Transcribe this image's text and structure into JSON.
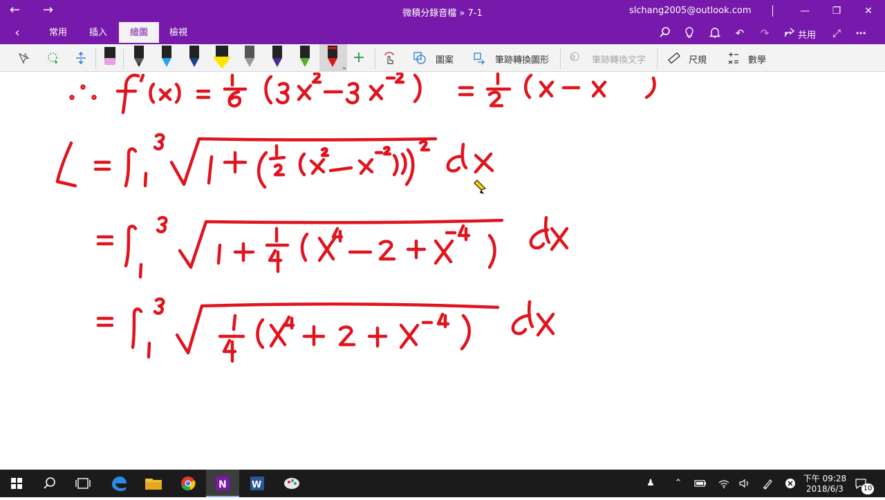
{
  "window": {
    "title": "微積分錄音檔 » 7-1",
    "account": "slchang2005@outlook.com",
    "back_icon": "back-arrow-icon",
    "forward_icon": "forward-arrow-icon"
  },
  "ribbon": {
    "tabs": [
      {
        "label": "常用"
      },
      {
        "label": "插入"
      },
      {
        "label": "繪圖",
        "active": true
      },
      {
        "label": "檢視"
      }
    ],
    "share_label": "共用",
    "accent": "#7719aa"
  },
  "toolbar": {
    "shapes_label": "圖案",
    "ink_to_shape_label": "筆跡轉換圖形",
    "ink_to_text_label": "筆跡轉換文字",
    "ruler_label": "尺規",
    "math_label": "數學",
    "pen_colors": [
      "#e8a0e0",
      "#1e1e1e",
      "#2aa3e6",
      "#1e3d8f",
      "#ffe600",
      "#9a9a9a",
      "#2a1a4a",
      "#55b02a",
      "#e0141e"
    ]
  },
  "canvas": {
    "ink_color": "#e0141e"
  },
  "taskbar": {
    "clock_time": "下午 09:28",
    "clock_date": "2018/6/3",
    "notification_count": "10"
  }
}
